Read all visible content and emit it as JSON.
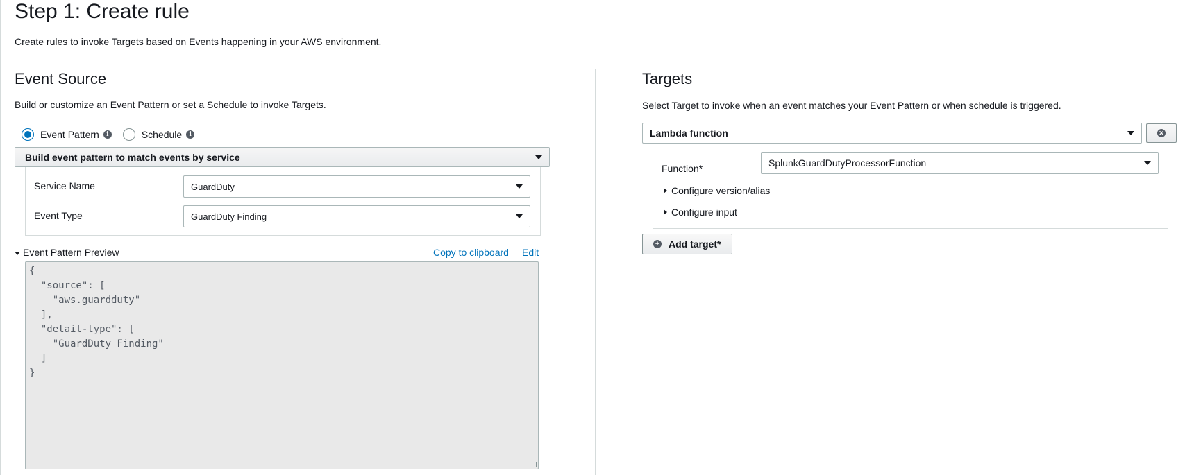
{
  "page": {
    "title": "Step 1: Create rule",
    "description": "Create rules to invoke Targets based on Events happening in your AWS environment."
  },
  "event_source": {
    "title": "Event Source",
    "description": "Build or customize an Event Pattern or set a Schedule to invoke Targets.",
    "radio_event_pattern": "Event Pattern",
    "radio_schedule": "Schedule",
    "selected_radio": "Event Pattern",
    "builder_dropdown": "Build event pattern to match events by service",
    "service_name_label": "Service Name",
    "service_name_value": "GuardDuty",
    "event_type_label": "Event Type",
    "event_type_value": "GuardDuty Finding",
    "preview_label": "Event Pattern Preview",
    "copy_link": "Copy to clipboard",
    "edit_link": "Edit",
    "pattern_code": "{\n  \"source\": [\n    \"aws.guardduty\"\n  ],\n  \"detail-type\": [\n    \"GuardDuty Finding\"\n  ]\n}"
  },
  "targets": {
    "title": "Targets",
    "description": "Select Target to invoke when an event matches your Event Pattern or when schedule is triggered.",
    "target_type": "Lambda function",
    "function_label": "Function*",
    "function_value": "SplunkGuardDutyProcessorFunction",
    "configure_version": "Configure version/alias",
    "configure_input": "Configure input",
    "add_target": "Add target*"
  },
  "colors": {
    "link": "#0073bb",
    "radio_selected": "#0073bb",
    "border": "#aab7b8",
    "code_bg": "#e9e9e9"
  },
  "icons": {
    "info": "info-icon",
    "remove": "close-circle-icon",
    "add": "plus-circle-icon",
    "caret": "caret-down-icon"
  }
}
